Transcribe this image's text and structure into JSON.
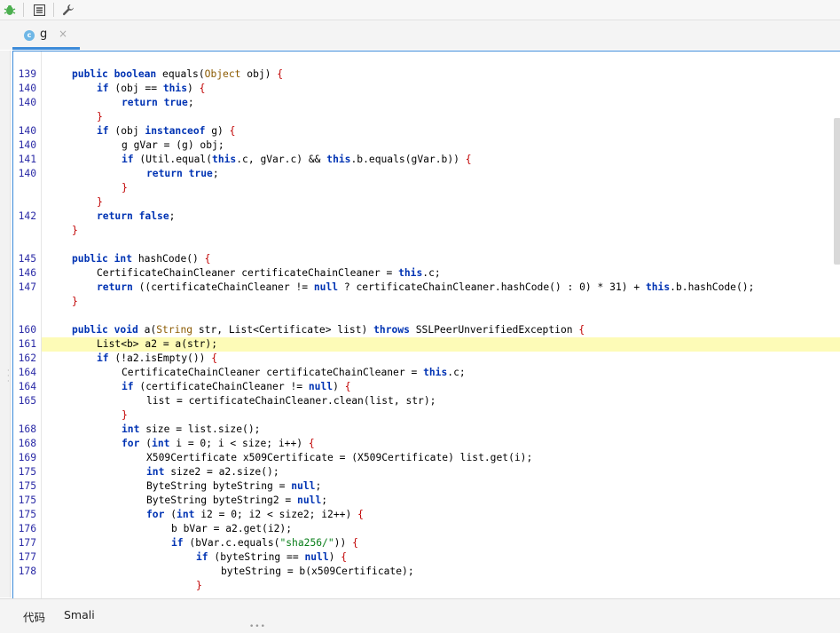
{
  "toolbar": {
    "icons": [
      "bug-icon",
      "list-icon",
      "wrench-icon"
    ]
  },
  "tab": {
    "label": "g",
    "close": "×",
    "icon_letter": "c"
  },
  "bottom_tabs": [
    {
      "label": "代码"
    },
    {
      "label": "Smali"
    }
  ],
  "code_lines": [
    {
      "n": "139",
      "indent": 0,
      "t": "public boolean equals(Object obj) {"
    },
    {
      "n": "140",
      "indent": 1,
      "t": "if (obj == this) {"
    },
    {
      "n": "140",
      "indent": 2,
      "t": "return true;"
    },
    {
      "n": "",
      "indent": 1,
      "t": "}"
    },
    {
      "n": "140",
      "indent": 1,
      "t": "if (obj instanceof g) {"
    },
    {
      "n": "140",
      "indent": 2,
      "t": "g gVar = (g) obj;"
    },
    {
      "n": "141",
      "indent": 2,
      "t": "if (Util.equal(this.c, gVar.c) && this.b.equals(gVar.b)) {"
    },
    {
      "n": "140",
      "indent": 3,
      "t": "return true;"
    },
    {
      "n": "",
      "indent": 2,
      "t": "}"
    },
    {
      "n": "",
      "indent": 1,
      "t": "}"
    },
    {
      "n": "142",
      "indent": 1,
      "t": "return false;"
    },
    {
      "n": "",
      "indent": 0,
      "t": "}"
    },
    {
      "n": "",
      "indent": 0,
      "t": ""
    },
    {
      "n": "145",
      "indent": 0,
      "t": "public int hashCode() {"
    },
    {
      "n": "146",
      "indent": 1,
      "t": "CertificateChainCleaner certificateChainCleaner = this.c;"
    },
    {
      "n": "147",
      "indent": 1,
      "t": "return ((certificateChainCleaner != null ? certificateChainCleaner.hashCode() : 0) * 31) + this.b.hashCode();"
    },
    {
      "n": "",
      "indent": 0,
      "t": "}"
    },
    {
      "n": "",
      "indent": 0,
      "t": ""
    },
    {
      "n": "160",
      "indent": 0,
      "t": "public void a(String str, List<Certificate> list) throws SSLPeerUnverifiedException {"
    },
    {
      "n": "161",
      "indent": 1,
      "t": "List<b> a2 = a(str);",
      "highlight": true
    },
    {
      "n": "162",
      "indent": 1,
      "t": "if (!a2.isEmpty()) {"
    },
    {
      "n": "164",
      "indent": 2,
      "t": "CertificateChainCleaner certificateChainCleaner = this.c;"
    },
    {
      "n": "164",
      "indent": 2,
      "t": "if (certificateChainCleaner != null) {"
    },
    {
      "n": "165",
      "indent": 3,
      "t": "list = certificateChainCleaner.clean(list, str);"
    },
    {
      "n": "",
      "indent": 2,
      "t": "}"
    },
    {
      "n": "168",
      "indent": 2,
      "t": "int size = list.size();"
    },
    {
      "n": "168",
      "indent": 2,
      "t": "for (int i = 0; i < size; i++) {"
    },
    {
      "n": "169",
      "indent": 3,
      "t": "X509Certificate x509Certificate = (X509Certificate) list.get(i);"
    },
    {
      "n": "175",
      "indent": 3,
      "t": "int size2 = a2.size();"
    },
    {
      "n": "175",
      "indent": 3,
      "t": "ByteString byteString = null;"
    },
    {
      "n": "175",
      "indent": 3,
      "t": "ByteString byteString2 = null;"
    },
    {
      "n": "175",
      "indent": 3,
      "t": "for (int i2 = 0; i2 < size2; i2++) {"
    },
    {
      "n": "176",
      "indent": 4,
      "t": "b bVar = a2.get(i2);"
    },
    {
      "n": "177",
      "indent": 4,
      "t": "if (bVar.c.equals(\"sha256/\")) {"
    },
    {
      "n": "177",
      "indent": 5,
      "t": "if (byteString == null) {"
    },
    {
      "n": "178",
      "indent": 6,
      "t": "byteString = b(x509Certificate);"
    },
    {
      "n": "",
      "indent": 5,
      "t": "}"
    }
  ]
}
